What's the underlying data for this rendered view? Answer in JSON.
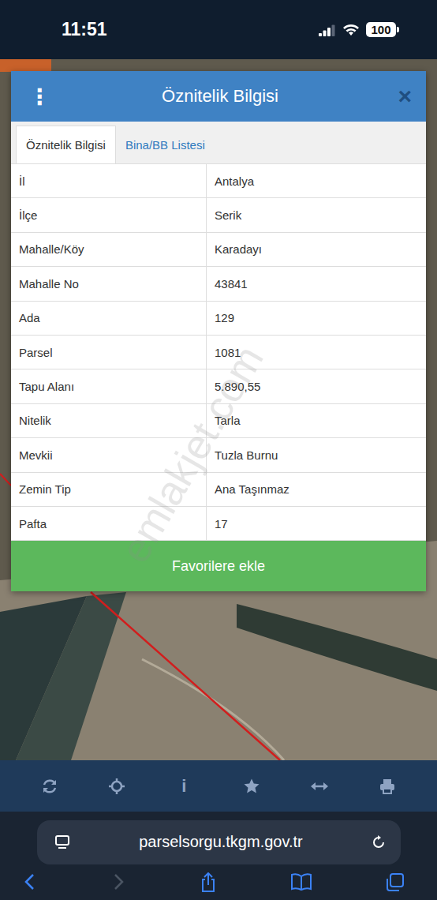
{
  "status_bar": {
    "time": "11:51",
    "battery": "100",
    "signal_level": 0.75
  },
  "dialog": {
    "title": "Öznitelik Bilgisi",
    "menu_icon": "⋮",
    "close_icon": "×",
    "tabs": [
      {
        "label": "Öznitelik Bilgisi",
        "selected": true
      },
      {
        "label": "Bina/BB Listesi",
        "selected": false
      }
    ],
    "rows": [
      {
        "label": "İl",
        "value": "Antalya"
      },
      {
        "label": "İlçe",
        "value": "Serik"
      },
      {
        "label": "Mahalle/Köy",
        "value": "Karadayı"
      },
      {
        "label": "Mahalle No",
        "value": "43841"
      },
      {
        "label": "Ada",
        "value": "129"
      },
      {
        "label": "Parsel",
        "value": "1081"
      },
      {
        "label": "Tapu Alanı",
        "value": "5.890,55"
      },
      {
        "label": "Nitelik",
        "value": "Tarla"
      },
      {
        "label": "Mevkii",
        "value": "Tuzla Burnu"
      },
      {
        "label": "Zemin Tip",
        "value": "Ana Taşınmaz"
      },
      {
        "label": "Pafta",
        "value": "17"
      }
    ],
    "button": "Favorilere ekle"
  },
  "watermark": "emlakjet.com",
  "toolbar": {
    "info_label": "i"
  },
  "browser": {
    "url": "parselsorgu.tkgm.gov.tr",
    "back_enabled": true,
    "forward_enabled": false
  }
}
